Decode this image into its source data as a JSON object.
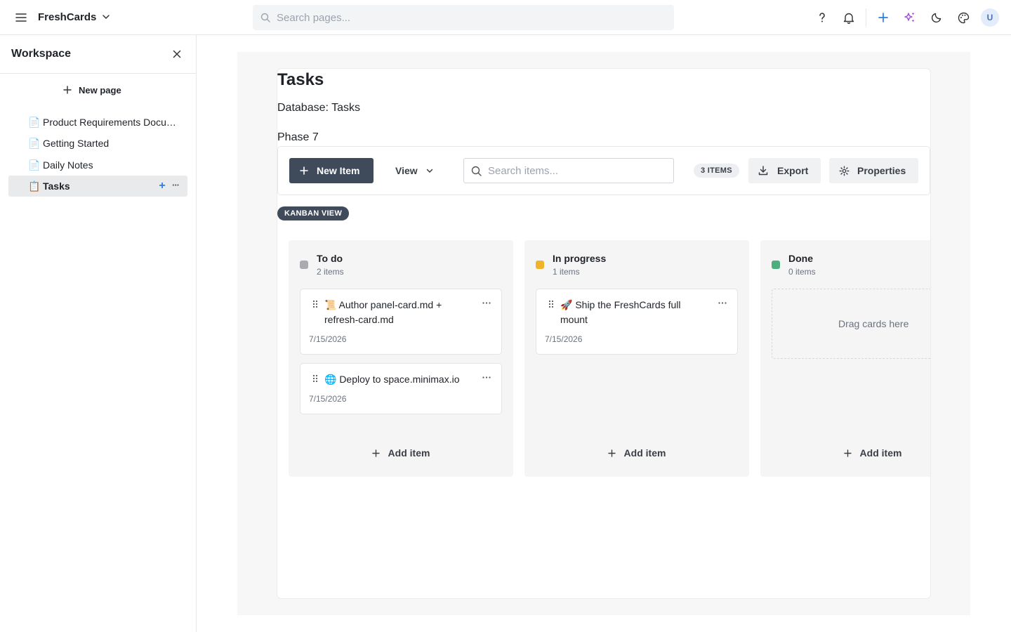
{
  "app": {
    "name": "FreshCards"
  },
  "search": {
    "placeholder": "Search pages..."
  },
  "topbar_icons": [
    "help-icon",
    "bell-icon",
    "plus-icon",
    "sparkle-icon",
    "moon-icon",
    "palette-icon"
  ],
  "user": {
    "initial": "U"
  },
  "sidebar": {
    "title": "Workspace",
    "new_page_label": "New page",
    "pages": [
      {
        "emoji": "📄",
        "label": "Product Requirements Document"
      },
      {
        "emoji": "📄",
        "label": "Getting Started"
      },
      {
        "emoji": "📄",
        "label": "Daily Notes"
      },
      {
        "emoji": "📋",
        "label": "Tasks",
        "active": true
      }
    ],
    "active_add": "+",
    "active_more": "···"
  },
  "page": {
    "title": "Tasks",
    "database_label": "Database: Tasks",
    "phase_label": "Phase 7"
  },
  "toolbar": {
    "new_item_label": "New Item",
    "view_label": "View",
    "search_placeholder": "Search items...",
    "count_label": "3 ITEMS",
    "export_label": "Export",
    "properties_label": "Properties"
  },
  "view_badge": "KANBAN VIEW",
  "kanban": {
    "add_item_label": "Add item",
    "columns": [
      {
        "name": "To do",
        "count": "2 items",
        "color": "#a9abb0",
        "cards": [
          {
            "title": "📜 Author panel-card.md + refresh-card.md",
            "date": "7/15/2026"
          },
          {
            "title": "🌐 Deploy to space.minimax.io",
            "date": "7/15/2026"
          }
        ]
      },
      {
        "name": "In progress",
        "count": "1 items",
        "color": "#f0b429",
        "cards": [
          {
            "title": "🚀 Ship the FreshCards full mount",
            "date": "7/15/2026"
          }
        ]
      },
      {
        "name": "Done",
        "count": "0 items",
        "color": "#4caf7d",
        "cards": [],
        "empty_text": "Drag cards here"
      }
    ]
  },
  "colors": {
    "primary_button": "#3f4a5a",
    "accent_blue": "#2b7de9",
    "accent_purple": "#9b4fd6"
  }
}
